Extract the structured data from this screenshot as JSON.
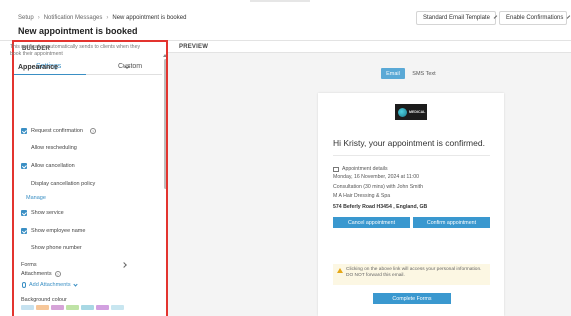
{
  "breadcrumb": {
    "items": [
      "Setup",
      "Notification Messages"
    ],
    "current": "New appointment is booked"
  },
  "page_title": "New appointment is booked",
  "header": {
    "template_select": "Standard Email Template",
    "enable_select": "Enable Confirmations"
  },
  "builder": {
    "heading": "BUILDER",
    "tabs": [
      "Settings",
      "Custom"
    ],
    "active_tab": "Settings",
    "description": "This notification automatically sends to clients when they book their appointment",
    "appearance_label": "Appearance",
    "options": [
      {
        "label": "Request confirmation",
        "checked": true,
        "info": true
      },
      {
        "label": "Allow rescheduling",
        "checked": false
      },
      {
        "label": "Allow cancellation",
        "checked": true
      },
      {
        "label": "Display cancellation policy",
        "checked": false
      },
      {
        "label": "Show service",
        "checked": true
      },
      {
        "label": "Show employee name",
        "checked": true
      },
      {
        "label": "Show phone number",
        "checked": false
      }
    ],
    "manage_link": "Manage",
    "forms_label": "Forms",
    "attachments_label": "Attachments",
    "add_attachments": "Add Attachments",
    "background_colour_label": "Background colour",
    "swatches": [
      "#c6e2f0",
      "#f6c79a",
      "#d6a4d8",
      "#bfe3a6",
      "#a8d8e4",
      "#d2a0e0",
      "#c8e6f0"
    ]
  },
  "preview": {
    "heading": "PREVIEW",
    "toggle_email": "Email",
    "toggle_sms": "SMS Text",
    "logo_text": "MEDICAL",
    "greeting": "Hi Kristy, your appointment is confirmed.",
    "details_label": "Appointment details",
    "date": "Monday, 16 November, 2024 at 11:00",
    "service": "Consultation (30 mins) with John Smith",
    "business": "M A Hair Dressing & Spa",
    "address": "574 Beferly Road H3454 , England, GB",
    "cancel_button": "Cancel appointment",
    "confirm_button": "Confirm appointment",
    "warning": "Clicking on the above link will access your personal information. DO NOT forward this email.",
    "complete_forms_button": "Complete Forms"
  }
}
